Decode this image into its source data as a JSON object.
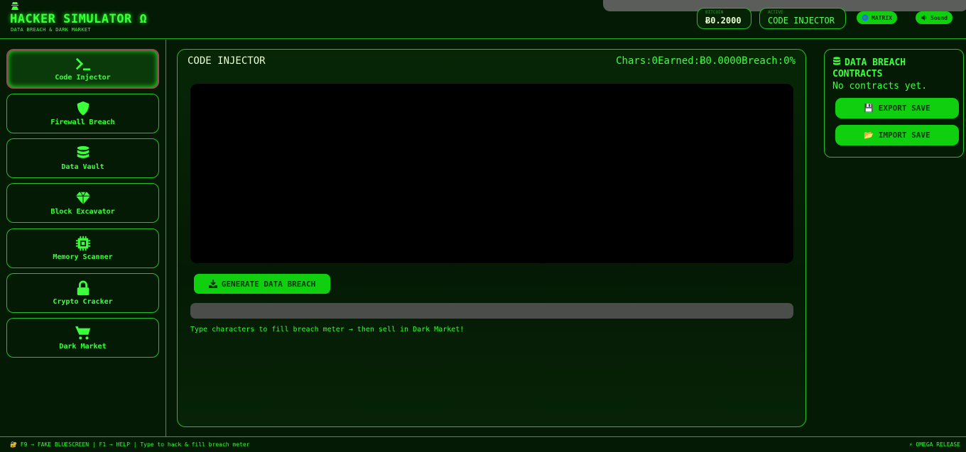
{
  "header": {
    "title": "HACKER SIMULATOR Ω",
    "subtitle": "DATA BREACH & DARK MARKET",
    "bitcoin": {
      "label": "BITCOIN",
      "value": "Ƀ0.2000"
    },
    "active": {
      "label": "ACTIVE",
      "value": "CODE INJECTOR"
    },
    "matrix_label": "MATRIX",
    "sound_label": "Sound"
  },
  "sidebar": {
    "items": [
      {
        "label": "Code Injector",
        "icon": "terminal-icon",
        "active": true
      },
      {
        "label": "Firewall Breach",
        "icon": "shield-icon"
      },
      {
        "label": "Data Vault",
        "icon": "database-icon"
      },
      {
        "label": "Block Excavator",
        "icon": "gem-icon"
      },
      {
        "label": "Memory Scanner",
        "icon": "chip-icon"
      },
      {
        "label": "Crypto Cracker",
        "icon": "lock-icon"
      },
      {
        "label": "Dark Market",
        "icon": "cart-icon"
      }
    ]
  },
  "main": {
    "title": "CODE INJECTOR",
    "stats": {
      "chars": "Chars:0",
      "earned": "Earned:Ƀ0.0000",
      "breach": "Breach:0%"
    },
    "generate_label": "GENERATE DATA BREACH",
    "breach_fraction": 0,
    "hint": "Type characters to fill breach meter → then sell in Dark Market!"
  },
  "contracts": {
    "title": "DATA BREACH CONTRACTS",
    "empty_text": "No contracts yet.",
    "export_label": "💾 EXPORT SAVE",
    "import_label": "📂 IMPORT SAVE"
  },
  "footer": {
    "left": "🔐 F9 → FAKE BLUESCREEN | F1 → HELP | Type to hack & fill breach meter",
    "right": "⚡ OMEGA RELEASE"
  },
  "colors": {
    "accent": "#0fcf0f",
    "text": "#3cff3c",
    "background": "#041a04"
  }
}
